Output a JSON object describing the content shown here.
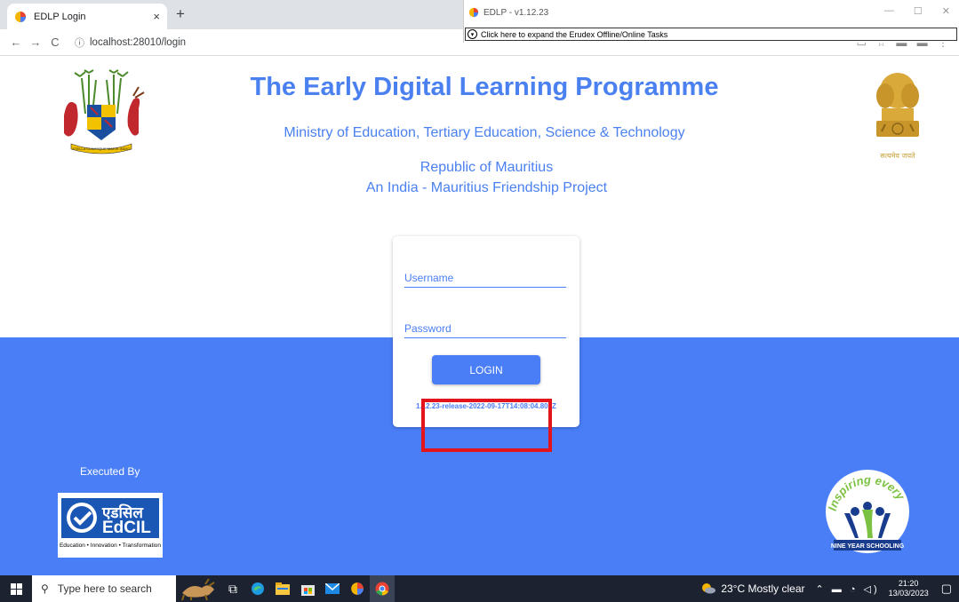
{
  "browser": {
    "tab_title": "EDLP Login",
    "tab_close": "×",
    "new_tab": "+",
    "back": "←",
    "forward": "→",
    "reload": "C",
    "info": "ⓘ",
    "url": "localhost:28010/login"
  },
  "overlay": {
    "title": "EDLP - v1.12.23",
    "minimize": "—",
    "maximize": "☐",
    "close": "✕",
    "expand_text": "Click here to expand the Erudex Offline/Online Tasks"
  },
  "page": {
    "title": "The Early Digital Learning Programme",
    "ministry": "Ministry of Education, Tertiary Education, Science & Technology",
    "republic": "Republic of Mauritius",
    "project": "An India - Mauritius Friendship Project",
    "emblem_caption": "सत्यमेव जयते"
  },
  "login": {
    "username_placeholder": "Username",
    "password_placeholder": "Password",
    "button_label": "LOGIN",
    "version": "1.12.23-release-2022-09-17T14:08:04.805Z"
  },
  "footer": {
    "executed_by": "Executed By",
    "edcil_hindi": "एडसिल",
    "edcil_name": "EdCIL",
    "edcil_tagline": "Education • Innovation • Transformation",
    "nys_arc": "Inspiring every child",
    "nys_banner": "NINE YEAR SCHOOLING"
  },
  "taskbar": {
    "search_placeholder": "Type here to search",
    "weather": "23°C Mostly clear",
    "time": "21:20",
    "date": "13/03/2023"
  },
  "colors": {
    "brand_blue": "#4a7ef7",
    "highlight_red": "#e3141c"
  }
}
